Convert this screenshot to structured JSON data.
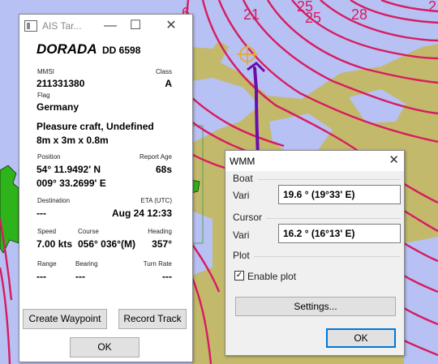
{
  "chart": {
    "contour_labels": [
      "6",
      "21",
      "25",
      "25",
      "28",
      "2"
    ],
    "colors": {
      "water": "#b7c1f4",
      "land": "#c3b96a",
      "contour": "#d81b60",
      "track": "#6a0dad",
      "scrub": "#2fb31a"
    }
  },
  "ais": {
    "title": "AIS Tar...",
    "name": "DORADA",
    "callsign": "DD 6598",
    "mmsi_label": "MMSI",
    "mmsi": "211331380",
    "class_label": "Class",
    "class": "A",
    "flag_label": "Flag",
    "flag": "Germany",
    "type": "Pleasure craft, Undefined",
    "dimensions": "8m x 3m x 0.8m",
    "position_label": "Position",
    "lat": "54° 11.9492' N",
    "lon": "009° 33.2699' E",
    "report_age_label": "Report Age",
    "report_age": "68s",
    "destination_label": "Destination",
    "destination": "---",
    "eta_label": "ETA (UTC)",
    "eta": "Aug 24 12:33",
    "speed_label": "Speed",
    "speed": "7.00 kts",
    "course_label": "Course",
    "course": "056° 036°(M)",
    "heading_label": "Heading",
    "heading": "357°",
    "range_label": "Range",
    "range": "---",
    "bearing_label": "Bearing",
    "bearing": "---",
    "turn_rate_label": "Turn Rate",
    "turn_rate": "---",
    "create_waypoint": "Create Waypoint",
    "record_track": "Record Track",
    "ok": "OK"
  },
  "wmm": {
    "title": "WMM",
    "boat_label": "Boat",
    "boat_vari_label": "Vari",
    "boat_vari": "19.6 ° (19°33' E)",
    "cursor_label": "Cursor",
    "cursor_vari_label": "Vari",
    "cursor_vari": "16.2 ° (16°13' E)",
    "plot_label": "Plot",
    "enable_plot_label": "Enable plot",
    "enable_plot": true,
    "settings": "Settings...",
    "ok": "OK"
  }
}
